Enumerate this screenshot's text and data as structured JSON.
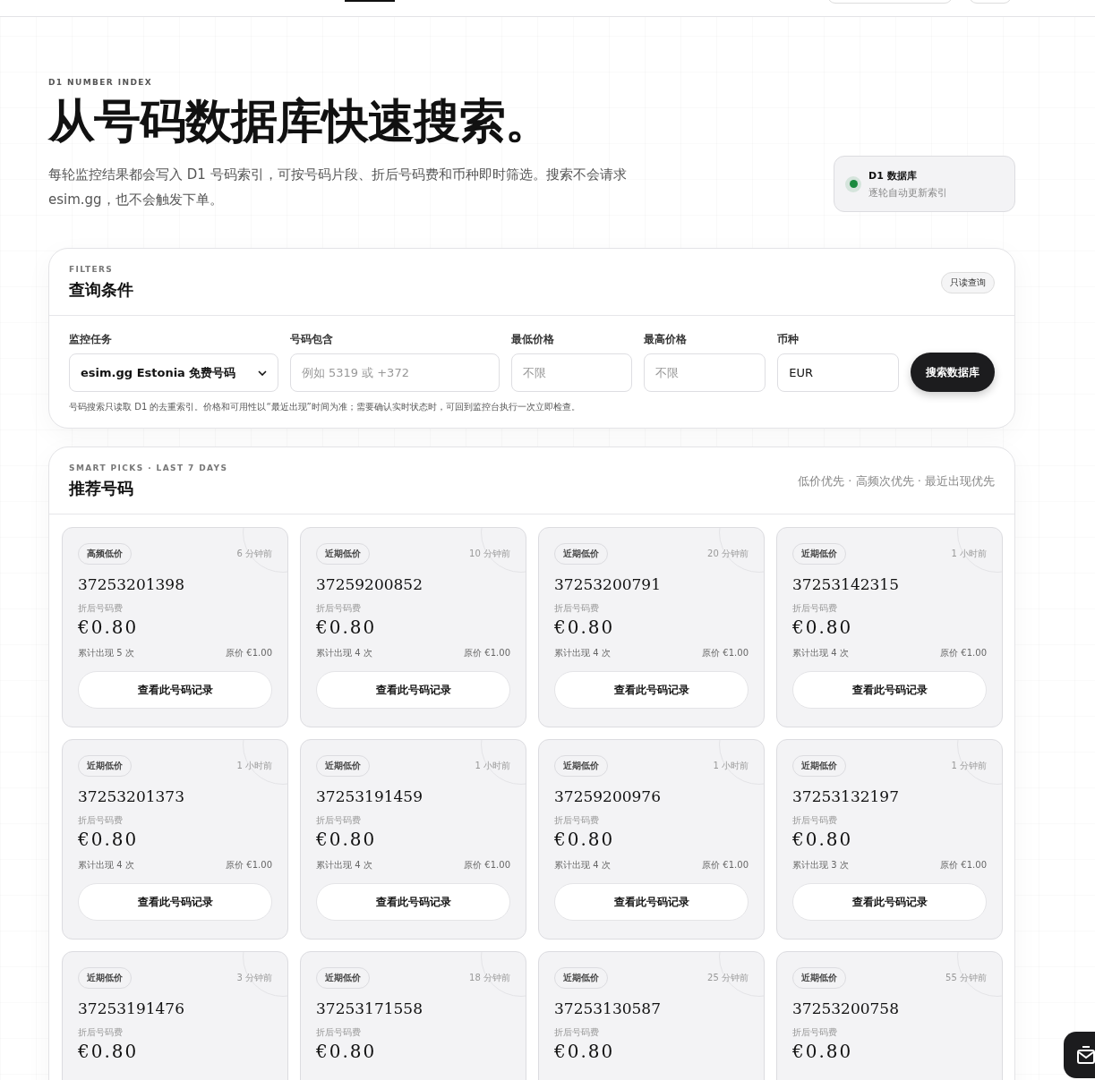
{
  "hero": {
    "eyebrow": "D1 NUMBER INDEX",
    "title": "从号码数据库快速搜索。",
    "description": "每轮监控结果都会写入 D1 号码索引，可按号码片段、折后号码费和币种即时筛选。搜索不会请求 esim.gg，也不会触发下单。"
  },
  "status": {
    "title": "D1 数据库",
    "subtitle": "逐轮自动更新索引",
    "color": "#1a8a3e"
  },
  "filters": {
    "eyebrow": "FILTERS",
    "title": "查询条件",
    "badge": "只读查询",
    "fields": [
      {
        "kind": "select",
        "label": "监控任务",
        "value": "esim.gg Estonia 免费号码"
      },
      {
        "kind": "input",
        "label": "号码包含",
        "placeholder": "例如 5319 或 +372"
      },
      {
        "kind": "input",
        "label": "最低价格",
        "placeholder": "不限"
      },
      {
        "kind": "input",
        "label": "最高价格",
        "placeholder": "不限"
      },
      {
        "kind": "input",
        "label": "币种",
        "value": "EUR"
      }
    ],
    "button": "搜索数据库",
    "hint": "号码搜索只读取 D1 的去重索引。价格和可用性以“最近出现”时间为准；需要确认实时状态时，可回到监控台执行一次立即检查。"
  },
  "picks": {
    "eyebrow": "SMART PICKS · LAST 7 DAYS",
    "title": "推荐号码",
    "sort_note": "低价优先 · 高频次优先 · 最近出现优先",
    "cards": [
      {
        "tag": "高频低价",
        "time": "6 分钟前",
        "number": "37253201398",
        "price_label": "折后号码费",
        "price": "€0.80",
        "count": "累计出现 5 次",
        "original": "原价 €1.00",
        "button": "查看此号码记录"
      },
      {
        "tag": "近期低价",
        "time": "10 分钟前",
        "number": "37259200852",
        "price_label": "折后号码费",
        "price": "€0.80",
        "count": "累计出现 4 次",
        "original": "原价 €1.00",
        "button": "查看此号码记录"
      },
      {
        "tag": "近期低价",
        "time": "20 分钟前",
        "number": "37253200791",
        "price_label": "折后号码费",
        "price": "€0.80",
        "count": "累计出现 4 次",
        "original": "原价 €1.00",
        "button": "查看此号码记录"
      },
      {
        "tag": "近期低价",
        "time": "1 小时前",
        "number": "37253142315",
        "price_label": "折后号码费",
        "price": "€0.80",
        "count": "累计出现 4 次",
        "original": "原价 €1.00",
        "button": "查看此号码记录"
      },
      {
        "tag": "近期低价",
        "time": "1 小时前",
        "number": "37253201373",
        "price_label": "折后号码费",
        "price": "€0.80",
        "count": "累计出现 4 次",
        "original": "原价 €1.00",
        "button": "查看此号码记录"
      },
      {
        "tag": "近期低价",
        "time": "1 小时前",
        "number": "37253191459",
        "price_label": "折后号码费",
        "price": "€0.80",
        "count": "累计出现 4 次",
        "original": "原价 €1.00",
        "button": "查看此号码记录"
      },
      {
        "tag": "近期低价",
        "time": "1 小时前",
        "number": "37259200976",
        "price_label": "折后号码费",
        "price": "€0.80",
        "count": "累计出现 4 次",
        "original": "原价 €1.00",
        "button": "查看此号码记录"
      },
      {
        "tag": "近期低价",
        "time": "1 分钟前",
        "number": "37253132197",
        "price_label": "折后号码费",
        "price": "€0.80",
        "count": "累计出现 3 次",
        "original": "原价 €1.00",
        "button": "查看此号码记录"
      },
      {
        "tag": "近期低价",
        "time": "3 分钟前",
        "number": "37253191476",
        "price_label": "折后号码费",
        "price": "€0.80"
      },
      {
        "tag": "近期低价",
        "time": "18 分钟前",
        "number": "37253171558",
        "price_label": "折后号码费",
        "price": "€0.80"
      },
      {
        "tag": "近期低价",
        "time": "25 分钟前",
        "number": "37253130587",
        "price_label": "折后号码费",
        "price": "€0.80"
      },
      {
        "tag": "近期低价",
        "time": "55 分钟前",
        "number": "37253200758",
        "price_label": "折后号码费",
        "price": "€0.80"
      }
    ]
  }
}
